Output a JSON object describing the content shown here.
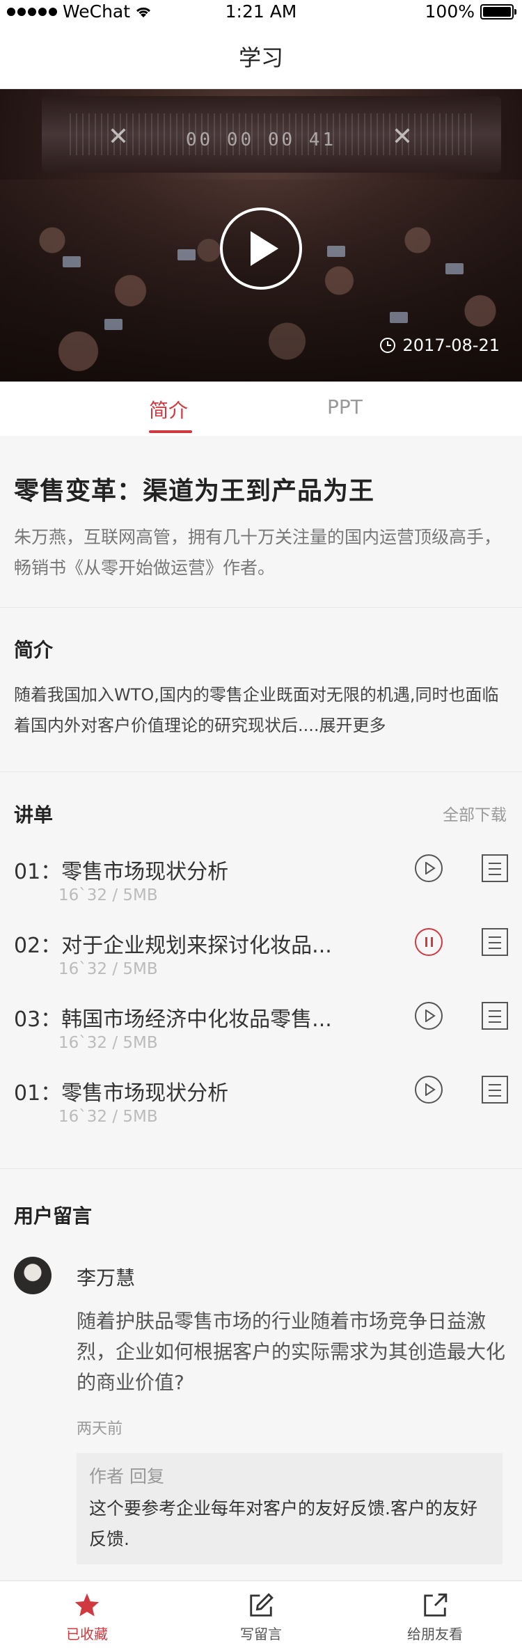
{
  "status_bar": {
    "carrier": "WeChat",
    "time": "1:21 AM",
    "battery": "100%"
  },
  "nav": {
    "title": "学习"
  },
  "video": {
    "countdown": "00 00 00 41",
    "date": "2017-08-21"
  },
  "tabs": [
    {
      "label": "简介",
      "active": true
    },
    {
      "label": "PPT",
      "active": false
    }
  ],
  "course": {
    "title": "零售变革：渠道为王到产品为王",
    "description": "朱万燕，互联网高管，拥有几十万关注量的国内运营顶级高手，畅销书《从零开始做运营》作者。"
  },
  "intro": {
    "heading": "简介",
    "text": "随着我国加入WTO,国内的零售企业既面对无限的机遇,同时也面临着国内外对客户价值理论的研究现状后....展开更多"
  },
  "lectures": {
    "heading": "讲单",
    "download_all": "全部下载",
    "items": [
      {
        "title": "01：零售市场现状分析",
        "meta": "16`32 / 5MB",
        "state": "play"
      },
      {
        "title": "02：对于企业规划来探讨化妆品...",
        "meta": "16`32 / 5MB",
        "state": "pause"
      },
      {
        "title": "03：韩国市场经济中化妆品零售...",
        "meta": "16`32 / 5MB",
        "state": "play"
      },
      {
        "title": "01：零售市场现状分析",
        "meta": "16`32 / 5MB",
        "state": "play"
      }
    ]
  },
  "comments": {
    "heading": "用户留言",
    "items": [
      {
        "user": "李万慧",
        "text": "随着护肤品零售市场的行业随着市场竞争日益激烈，企业如何根据客户的实际需求为其创造最大化的商业价值?",
        "time": "两天前",
        "reply_label": "作者 回复",
        "reply_text": "这个要参考企业每年对客户的友好反馈.客户的友好反馈."
      }
    ]
  },
  "tabbar": [
    {
      "label": "已收藏",
      "icon": "star-icon",
      "active": true
    },
    {
      "label": "写留言",
      "icon": "edit-icon",
      "active": false
    },
    {
      "label": "给朋友看",
      "icon": "share-icon",
      "active": false
    }
  ],
  "colors": {
    "accent": "#d0393f",
    "background": "#f6f6f6"
  }
}
